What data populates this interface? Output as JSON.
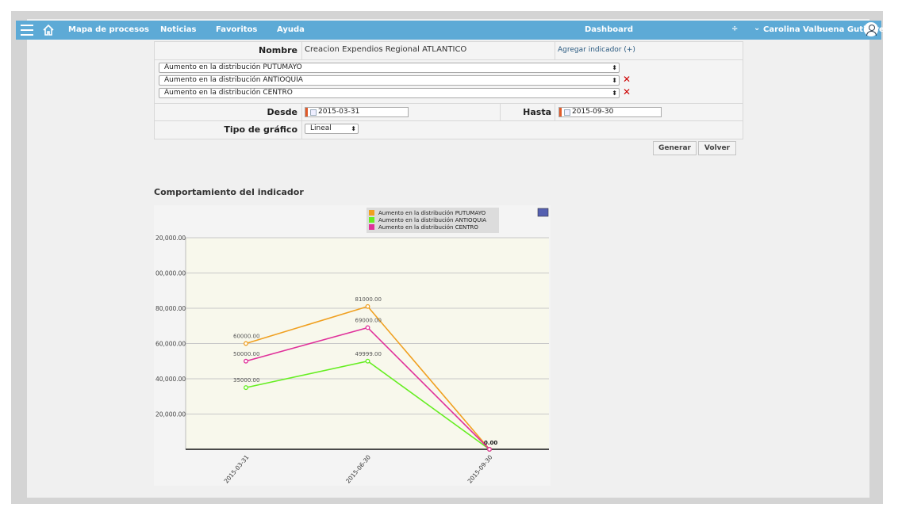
{
  "nav": {
    "items": [
      "Mapa de procesos",
      "Noticias",
      "Favoritos",
      "Ayuda"
    ],
    "center": "Dashboard",
    "updown": "÷",
    "user": "Carolina Valbuena Gutierrez"
  },
  "form": {
    "nombre_label": "Nombre",
    "nombre_value": "Creacion Expendios Regional ATLANTICO",
    "add_link": "Agregar indicador (+)",
    "indicators": [
      "Aumento en la distribución PUTUMAYO",
      "Aumento en la distribución ANTIOQUIA",
      "Aumento en la distribución CENTRO"
    ],
    "remove_icon": "✕",
    "desde_label": "Desde",
    "desde_value": "2015-03-31",
    "hasta_label": "Hasta",
    "hasta_value": "2015-09-30",
    "tipo_label": "Tipo de gráfico",
    "tipo_value": "Lineal",
    "generar": "Generar",
    "volver": "Volver",
    "select_arrow": "⬍"
  },
  "chart_title": "Comportamiento del indicador",
  "chart_data": {
    "type": "line",
    "x": [
      "2015-03-31",
      "2015-06-30",
      "2015-09-30"
    ],
    "series": [
      {
        "name": "Aumento en la distribución PUTUMAYO",
        "values": [
          60000,
          81000,
          0
        ],
        "labels": [
          "60000.00",
          "81000.00",
          "0.00"
        ],
        "color": "#f0a020"
      },
      {
        "name": "Aumento en la distribución ANTIOQUIA",
        "values": [
          35000,
          49999,
          0
        ],
        "labels": [
          "35000.00",
          "49999.00",
          ""
        ],
        "color": "#66ee22"
      },
      {
        "name": "Aumento en la distribución CENTRO",
        "values": [
          50000,
          69000,
          0
        ],
        "labels": [
          "50000.00",
          "69000.00",
          ""
        ],
        "color": "#e0309a"
      }
    ],
    "yticks": [
      20000,
      40000,
      60000,
      80000,
      100000,
      120000
    ],
    "ytick_labels": [
      "20,000.00",
      "40,000.00",
      "60,000.00",
      "80,000.00",
      "00,000.00",
      "20,000.00"
    ],
    "ylim": [
      0,
      120000
    ],
    "legend": "top-center",
    "grid": true,
    "plot_bg": "#f8f8ec"
  }
}
